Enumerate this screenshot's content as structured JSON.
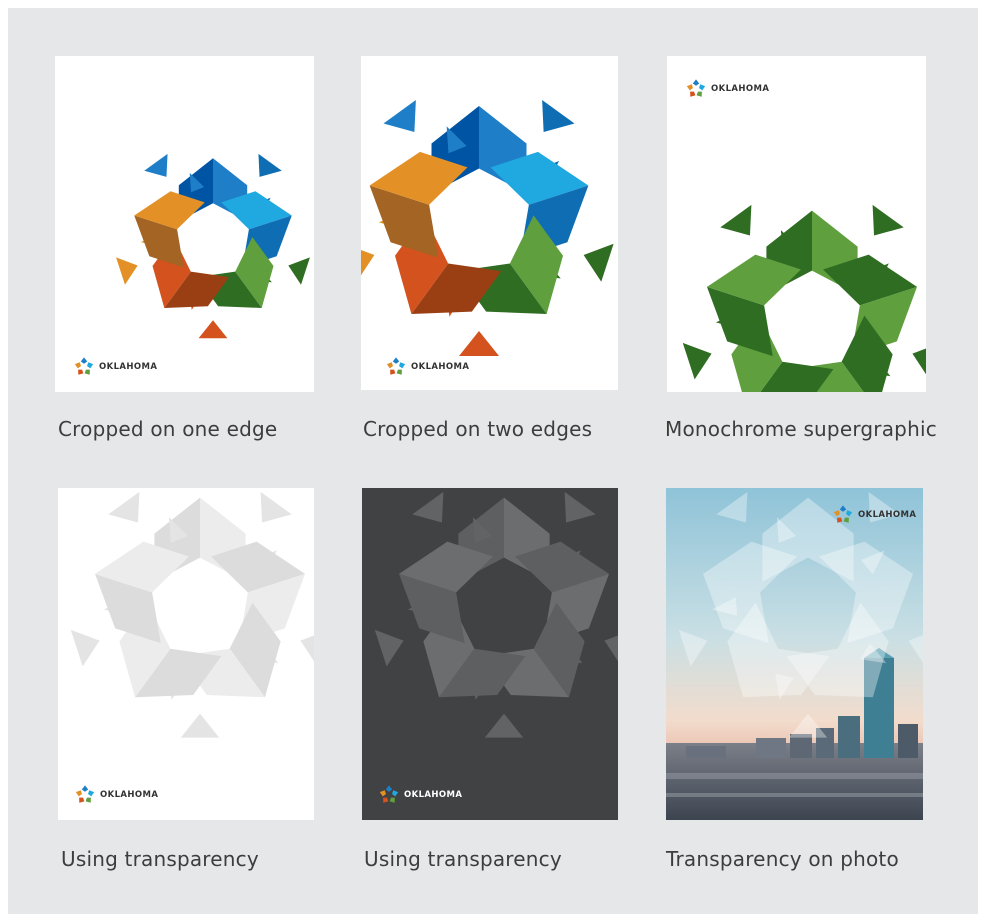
{
  "colors": {
    "panel": "#e6e7e8",
    "dark_card": "#414244",
    "navy": "#0054a4",
    "blue": "#1e7fc8",
    "sky": "#20a8e0",
    "steel": "#0f6db3",
    "green": "#5f9f3e",
    "dark_green": "#2f6d22",
    "rust": "#9a3f14",
    "orange": "#d4521e",
    "amber": "#e39127",
    "brown": "#a36424"
  },
  "cards": [
    {
      "id": "cropped-one-edge",
      "caption": "Cropped on one edge",
      "logo_text": "OKLAHOMA"
    },
    {
      "id": "cropped-two-edges",
      "caption": "Cropped on two edges",
      "logo_text": "OKLAHOMA"
    },
    {
      "id": "monochrome",
      "caption": "Monochrome supergraphic",
      "logo_text": "OKLAHOMA"
    },
    {
      "id": "transparency-white",
      "caption": "Using transparency",
      "logo_text": "OKLAHOMA"
    },
    {
      "id": "transparency-dark",
      "caption": "Using transparency",
      "logo_text": "OKLAHOMA"
    },
    {
      "id": "transparency-photo",
      "caption": "Transparency on photo",
      "logo_text": "OKLAHOMA"
    }
  ]
}
